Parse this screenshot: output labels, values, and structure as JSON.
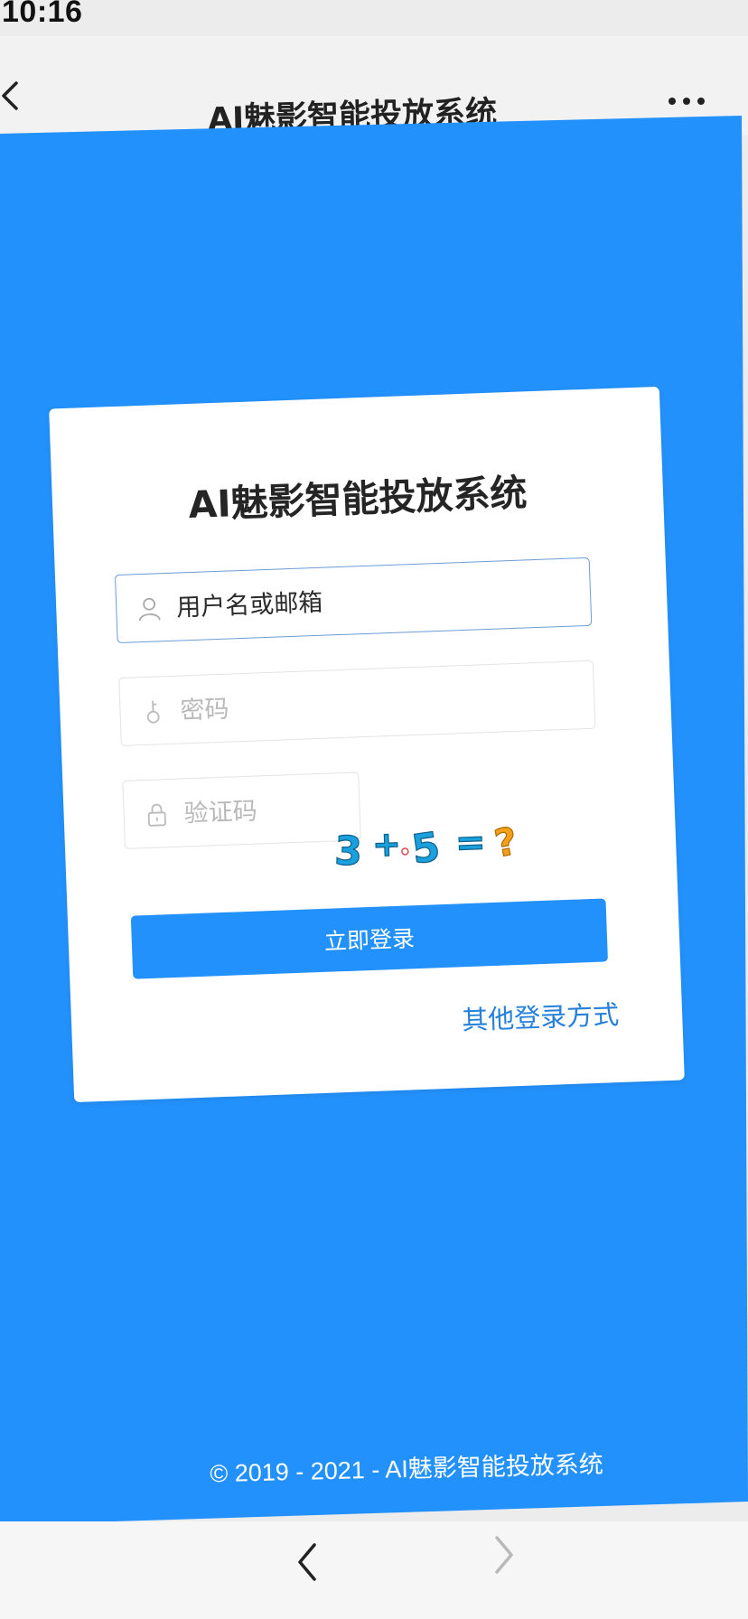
{
  "status_bar": {
    "time": "10:16"
  },
  "navbar": {
    "title": "AI魅影智能投放系统"
  },
  "login_card": {
    "title": "AI魅影智能投放系统",
    "username_placeholder": "用户名或邮箱",
    "password_placeholder": "密码",
    "captcha_placeholder": "验证码",
    "captcha_text": "3+5=?",
    "login_button": "立即登录",
    "other_login_link": "其他登录方式"
  },
  "footer": {
    "copyright": "© 2019 - 2021 - AI魅影智能投放系统"
  },
  "colors": {
    "primary": "#2391fb",
    "link": "#2780d9",
    "captcha_blue": "#1aa0dc",
    "captcha_orange": "#f2a01a"
  },
  "icons": [
    "back-icon",
    "more-icon",
    "user-icon",
    "key-icon",
    "lock-icon",
    "chevron-left-icon",
    "chevron-right-icon"
  ]
}
